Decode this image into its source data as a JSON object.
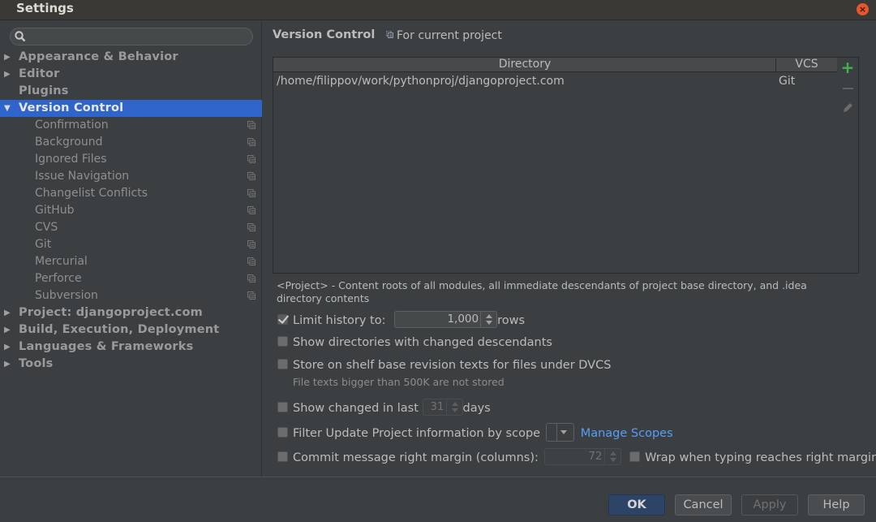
{
  "window": {
    "title": "Settings",
    "close_icon": "close-icon"
  },
  "search": {
    "placeholder": "",
    "value": ""
  },
  "tree": {
    "top_before": [
      {
        "label": "Appearance & Behavior",
        "expandable": true
      },
      {
        "label": "Editor",
        "expandable": true
      },
      {
        "label": "Plugins",
        "expandable": false
      }
    ],
    "selected": {
      "label": "Version Control",
      "expanded": true
    },
    "children": [
      "Confirmation",
      "Background",
      "Ignored Files",
      "Issue Navigation",
      "Changelist Conflicts",
      "GitHub",
      "CVS",
      "Git",
      "Mercurial",
      "Perforce",
      "Subversion"
    ],
    "top_after": [
      {
        "label": "Project: djangoproject.com",
        "expandable": true
      },
      {
        "label": "Build, Execution, Deployment",
        "expandable": true
      },
      {
        "label": "Languages & Frameworks",
        "expandable": true
      },
      {
        "label": "Tools",
        "expandable": true
      }
    ]
  },
  "main": {
    "header": "Version Control",
    "scope_label": "For current project",
    "table": {
      "columns": [
        "Directory",
        "VCS"
      ],
      "rows": [
        {
          "directory": "/home/filippov/work/pythonproj/djangoproject.com",
          "vcs": "Git"
        }
      ]
    },
    "note": "<Project> - Content roots of all modules, all immediate descendants of project base directory, and .idea directory contents",
    "options": {
      "limit_history": {
        "checked": true,
        "label": "Limit history to:",
        "value": "1,000",
        "suffix": "rows"
      },
      "show_dirs": {
        "checked": false,
        "label": "Show directories with changed descendants"
      },
      "store_shelf": {
        "checked": false,
        "label": "Store on shelf base revision texts for files under DVCS",
        "hint": "File texts bigger than 500K are not stored"
      },
      "show_changed": {
        "checked": false,
        "label": "Show changed in last",
        "value": "31",
        "suffix": "days"
      },
      "filter_update": {
        "checked": false,
        "label": "Filter Update Project information by scope",
        "dropdown_value": "",
        "link": "Manage Scopes"
      },
      "commit_margin": {
        "checked": false,
        "label": "Commit message right margin (columns):",
        "value": "72"
      },
      "wrap_typing": {
        "checked": false,
        "label": "Wrap when typing reaches right margin"
      }
    }
  },
  "footer": {
    "ok": "OK",
    "cancel": "Cancel",
    "apply": "Apply",
    "help": "Help"
  }
}
